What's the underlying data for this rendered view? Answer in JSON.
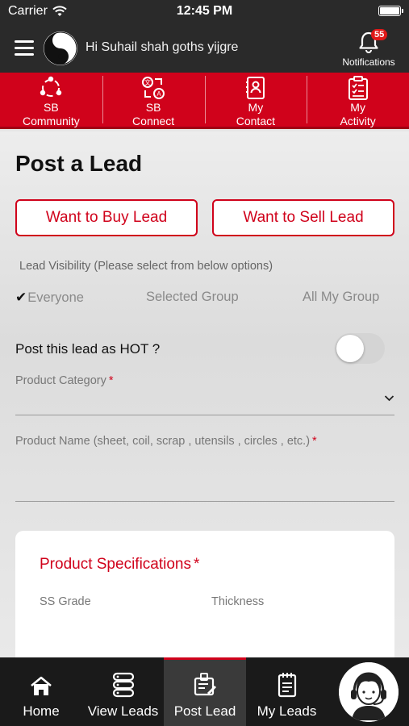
{
  "status_bar": {
    "carrier": "Carrier",
    "time": "12:45 PM"
  },
  "header": {
    "greeting": "Hi Suhail shah goths yijgre",
    "notifications_label": "Notifications",
    "notifications_count": "55"
  },
  "top_nav": [
    {
      "label_1": "SB",
      "label_2": "Community",
      "icon": "community-icon"
    },
    {
      "label_1": "SB",
      "label_2": "Connect",
      "icon": "connect-icon"
    },
    {
      "label_1": "My",
      "label_2": "Contact",
      "icon": "contact-card-icon"
    },
    {
      "label_1": "My",
      "label_2": "Activity",
      "icon": "clipboard-icon"
    }
  ],
  "page": {
    "title": "Post a Lead",
    "buy_button": "Want to Buy Lead",
    "sell_button": "Want to Sell Lead",
    "visibility_label": "Lead Visibility (Please select from below options)",
    "visibility_options": [
      {
        "label": "Everyone",
        "checked": true
      },
      {
        "label": "Selected Group",
        "checked": false
      },
      {
        "label": "All My Group",
        "checked": false
      }
    ],
    "hot_label": "Post this lead as HOT ?",
    "hot_enabled": false,
    "category_label": "Product Category",
    "product_name_label": "Product Name (sheet, coil, scrap , utensils , circles , etc.)",
    "required_mark": "*",
    "spec_title": "Product Specifications",
    "spec_ss_grade": "SS Grade",
    "spec_thickness": "Thickness"
  },
  "bottom_nav": [
    {
      "label": "Home",
      "icon": "home-icon",
      "active": false
    },
    {
      "label": "View Leads",
      "icon": "database-icon",
      "active": false
    },
    {
      "label": "Post Lead",
      "icon": "post-lead-icon",
      "active": true
    },
    {
      "label": "My Leads",
      "icon": "notepad-icon",
      "active": false
    }
  ],
  "colors": {
    "brand_red": "#d0021b",
    "header_dark": "#2a2a2a",
    "bottom_nav": "#1a1a1a"
  }
}
